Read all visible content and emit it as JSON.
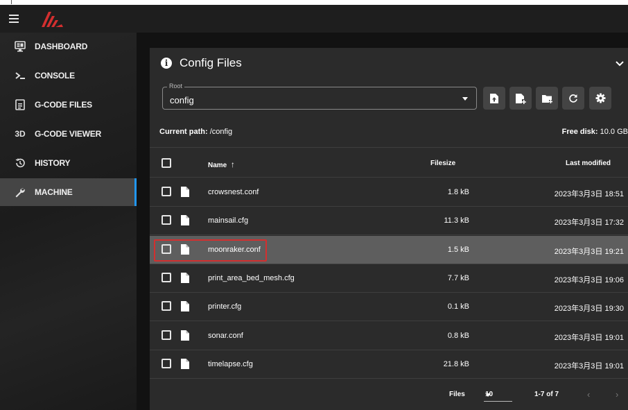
{
  "sidebar": {
    "items": [
      {
        "label": "DASHBOARD",
        "icon": "monitor-dashboard-icon"
      },
      {
        "label": "CONSOLE",
        "icon": "console-icon"
      },
      {
        "label": "G-CODE FILES",
        "icon": "file-document-icon"
      },
      {
        "label": "G-CODE VIEWER",
        "icon": "3d-icon",
        "icon_text": "3D"
      },
      {
        "label": "HISTORY",
        "icon": "history-icon"
      },
      {
        "label": "MACHINE",
        "icon": "wrench-icon",
        "active": true
      }
    ]
  },
  "card": {
    "title": "Config Files",
    "root": {
      "legend": "Root",
      "value": "config"
    },
    "current_path_label": "Current path:",
    "current_path": "/config",
    "free_disk_label": "Free disk:",
    "free_disk": "10.0 GB",
    "columns": {
      "name": "Name",
      "sort_indicator": "↑",
      "filesize": "Filesize",
      "last_modified": "Last modified"
    },
    "rows": [
      {
        "name": "crowsnest.conf",
        "size": "1.8 kB",
        "modified": "2023年3月3日 18:51"
      },
      {
        "name": "mainsail.cfg",
        "size": "11.3 kB",
        "modified": "2023年3月3日 17:32"
      },
      {
        "name": "moonraker.conf",
        "size": "1.5 kB",
        "modified": "2023年3月3日 19:21",
        "selected": true
      },
      {
        "name": "print_area_bed_mesh.cfg",
        "size": "7.7 kB",
        "modified": "2023年3月3日 19:06"
      },
      {
        "name": "printer.cfg",
        "size": "0.1 kB",
        "modified": "2023年3月3日 19:30"
      },
      {
        "name": "sonar.conf",
        "size": "0.8 kB",
        "modified": "2023年3月3日 19:01"
      },
      {
        "name": "timelapse.cfg",
        "size": "21.8 kB",
        "modified": "2023年3月3日 19:01"
      }
    ],
    "footer": {
      "files_label": "Files",
      "per_page": "10",
      "range": "1-7 of 7",
      "prev": "‹",
      "next": "›"
    }
  },
  "colors": {
    "accent": "#2196f3",
    "logo": "#d32f2f",
    "highlight": "#d32f2f"
  }
}
